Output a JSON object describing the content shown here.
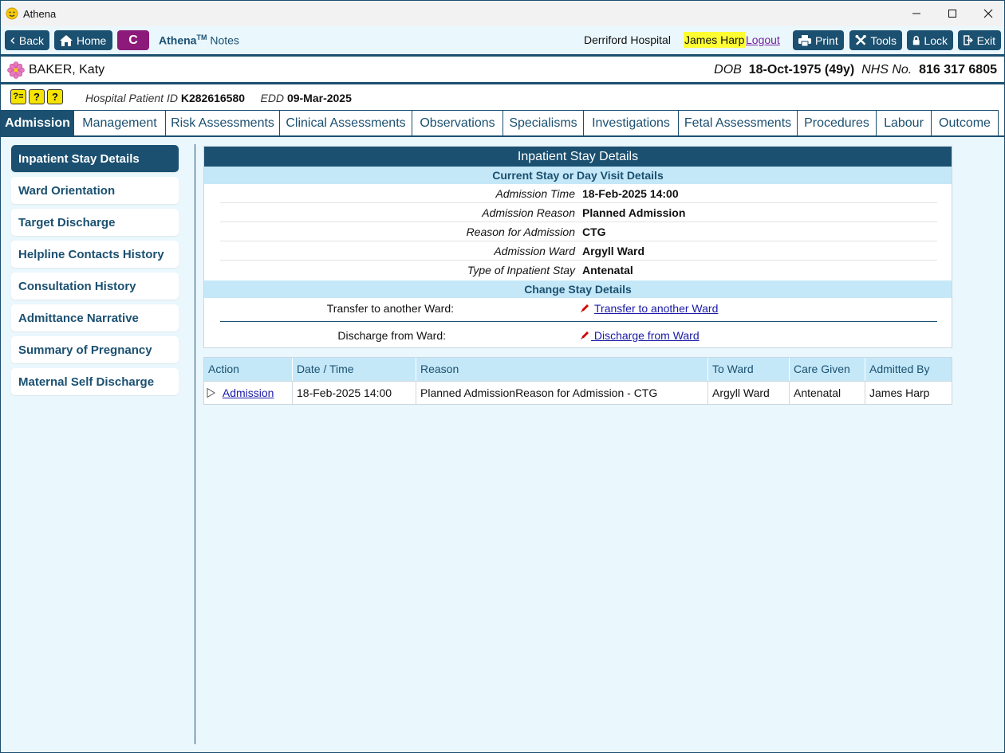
{
  "window": {
    "title": "Athena",
    "controls": [
      "minimize",
      "maximize",
      "close"
    ]
  },
  "toolbar": {
    "back_label": "Back",
    "home_label": "Home",
    "c_label": "C",
    "brand_name": "Athena",
    "brand_tm": "TM",
    "brand_suffix": " Notes",
    "hospital": "Derriford Hospital",
    "user": "James Harp",
    "logout_label": "Logout",
    "print_label": "Print",
    "tools_label": "Tools",
    "lock_label": "Lock",
    "exit_label": "Exit"
  },
  "patient": {
    "name": "BAKER, Katy",
    "dob_label": "DOB",
    "dob": "18-Oct-1975 (49y)",
    "nhs_label": "NHS No.",
    "nhs": "816 317 6805",
    "hpid_label": "Hospital Patient ID",
    "hpid": "K282616580",
    "edd_label": "EDD",
    "edd": "09-Mar-2025",
    "help_icons": [
      "?≡",
      "?",
      "?"
    ]
  },
  "tabs": [
    {
      "label": "Admission",
      "active": true
    },
    {
      "label": "Management"
    },
    {
      "label": "Risk Assessments"
    },
    {
      "label": "Clinical Assessments"
    },
    {
      "label": "Observations"
    },
    {
      "label": "Specialisms"
    },
    {
      "label": "Investigations"
    },
    {
      "label": "Fetal Assessments"
    },
    {
      "label": "Procedures"
    },
    {
      "label": "Labour"
    },
    {
      "label": "Outcome"
    }
  ],
  "sidebar": {
    "items": [
      {
        "label": "Inpatient Stay Details",
        "active": true
      },
      {
        "label": "Ward Orientation"
      },
      {
        "label": "Target Discharge"
      },
      {
        "label": "Helpline Contacts History"
      },
      {
        "label": "Consultation History"
      },
      {
        "label": "Admittance Narrative"
      },
      {
        "label": "Summary of Pregnancy"
      },
      {
        "label": "Maternal Self Discharge"
      }
    ]
  },
  "panel": {
    "title": "Inpatient Stay Details",
    "current_section": "Current Stay or Day Visit Details",
    "fields": [
      {
        "label": "Admission Time",
        "value": "18-Feb-2025 14:00"
      },
      {
        "label": "Admission Reason",
        "value": "Planned Admission"
      },
      {
        "label": "Reason for Admission",
        "value": "CTG"
      },
      {
        "label": "Admission Ward",
        "value": "Argyll Ward"
      },
      {
        "label": "Type of Inpatient Stay",
        "value": "Antenatal"
      }
    ],
    "change_section": "Change Stay Details",
    "changes": [
      {
        "label": "Transfer to another Ward:",
        "link": "Transfer to another Ward"
      },
      {
        "label": "Discharge from Ward:",
        "link": " Discharge from Ward"
      }
    ]
  },
  "table": {
    "columns": [
      "Action",
      "Date / Time",
      "Reason",
      "To Ward",
      "Care Given",
      "Admitted By"
    ],
    "rows": [
      {
        "action": "Admission",
        "datetime": "18-Feb-2025 14:00",
        "reason": "Planned AdmissionReason for Admission - CTG",
        "to_ward": "Argyll Ward",
        "care_given": "Antenatal",
        "admitted_by": "James Harp"
      }
    ]
  },
  "colors": {
    "primary": "#1b5070",
    "light_bg": "#eaf7fd",
    "subheader_bg": "#c4e8f8",
    "user_highlight": "#ffff33",
    "logout": "#7a1fa0",
    "link": "#1a1aa8",
    "c_button": "#8b1a7a"
  }
}
